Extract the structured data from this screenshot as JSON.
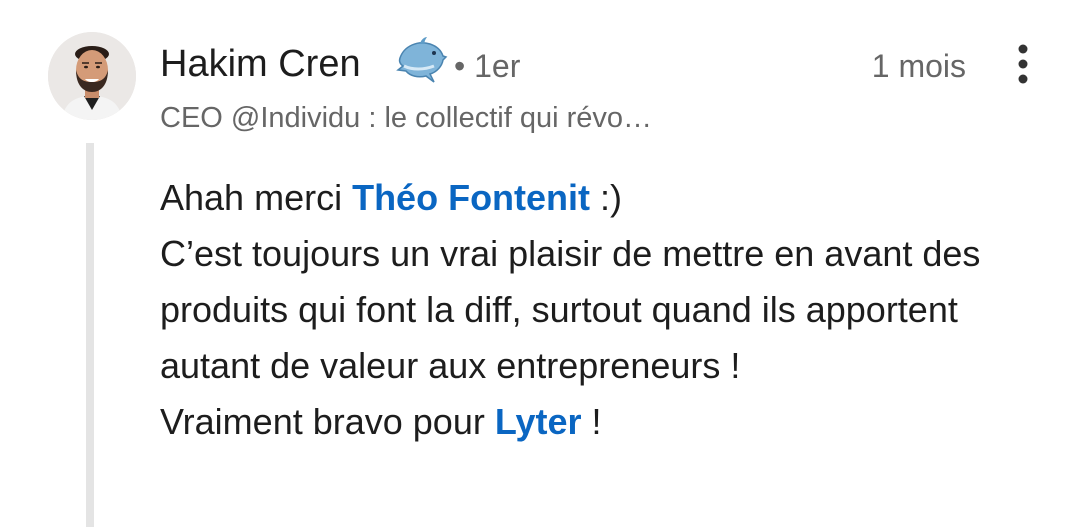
{
  "comment": {
    "author": "Hakim Cren",
    "emoji": "dolphin-icon",
    "degree": "• 1er",
    "time": "1 mois",
    "headline": "CEO @Individu : le collectif qui révo…",
    "more": "more-vertical-icon",
    "body": {
      "line1_before": "Ahah merci ",
      "mention1": "Théo Fontenit",
      "line1_after": " :)",
      "paragraph": "C’est toujours un vrai plaisir de mettre en avant des produits qui font la diff, surtout quand ils apportent autant de valeur aux entrepreneurs !",
      "line3_before": "Vraiment bravo pour ",
      "mention2": "Lyter",
      "line3_after": " !"
    }
  },
  "colors": {
    "text": "#1d1d1d",
    "secondary": "#666666",
    "link": "#0a66c2",
    "thread_line": "#e4e4e4"
  }
}
